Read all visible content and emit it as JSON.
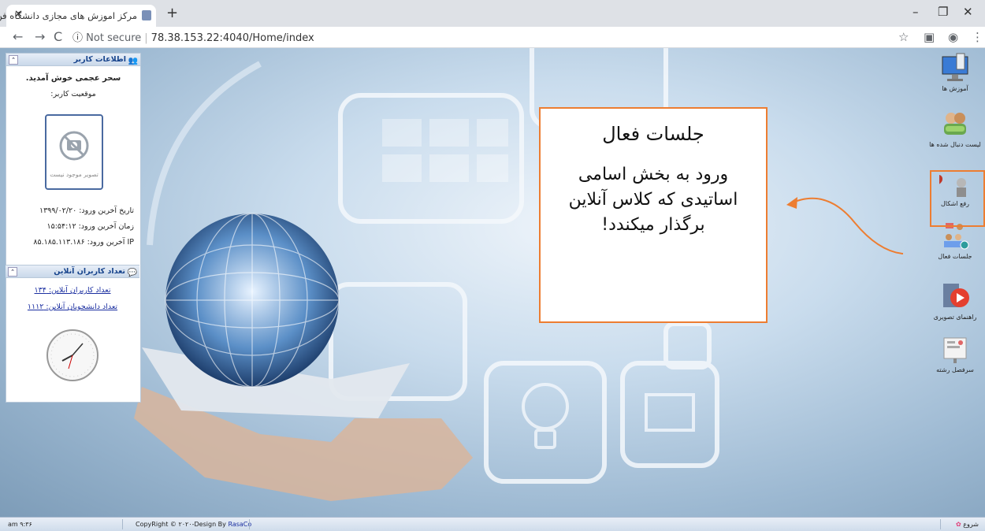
{
  "browser": {
    "tab_title": "مرکز اموزش های مجازی دانشگاه فن",
    "url_prefix": "Not secure",
    "url": "78.38.153.22:4040/Home/index"
  },
  "user_panel": {
    "header": "اطلاعات کاربر",
    "welcome": "سحر عجمی خوش آمدید.",
    "status_label": "موقعیت کاربر:",
    "photo_missing": "تصویر موجود نیست",
    "last_login_date": "تاریخ آخرین ورود: ۱۳۹۹/۰۲/۲۰",
    "last_login_time": "زمان آخرین ورود: ۱۵:۵۴:۱۲",
    "last_login_ip": "IP آخرین ورود: ۸۵.۱۸۵.۱۱۳.۱۸۶"
  },
  "online_panel": {
    "header": "تعداد کاربران آنلاین",
    "users_online": "تعداد کاربران آنلاین: ۱۳۴",
    "students_online": "تعداد دانشجویان آنلاین: ۱۱۱۲"
  },
  "callout": {
    "title": "جلسات فعال",
    "body": "ورود به بخش اسامی اساتیدی که کلاس آنلاین برگذار میکندد!"
  },
  "sidebar": {
    "items": [
      {
        "label": "آموزش ها",
        "icon": "monitor-icon"
      },
      {
        "label": "لیست دنبال شده ها",
        "icon": "follow-icon"
      },
      {
        "label": "رفع اشکال",
        "icon": "question-icon"
      },
      {
        "label": "جلسات فعال",
        "icon": "meeting-icon"
      },
      {
        "label": "راهنمای تصویری",
        "icon": "video-guide-icon"
      },
      {
        "label": "سرفصل رشته",
        "icon": "curriculum-icon"
      }
    ]
  },
  "footer": {
    "time": "am ۹:۳۶",
    "copyright": "CopyRight © ۲۰۲۰-Design By",
    "designer": "RasaCo",
    "start": "شروع"
  },
  "colors": {
    "highlight": "#ed7d31",
    "link": "#1a2ea0",
    "panel_header": "#15428b"
  }
}
